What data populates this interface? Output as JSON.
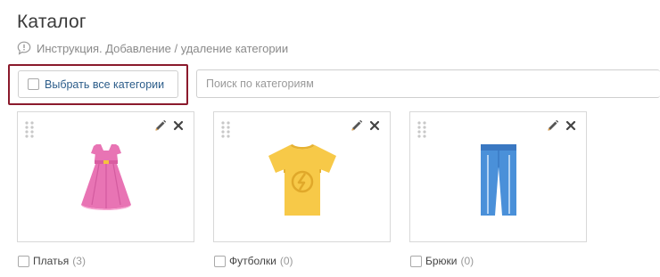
{
  "header": {
    "title": "Каталог",
    "help_text": "Инструкция. Добавление / удаление категории"
  },
  "toolbar": {
    "select_all_label": "Выбрать все категории",
    "search_placeholder": "Поиск по категориям",
    "search_value": ""
  },
  "categories": [
    {
      "name": "Платья",
      "count": "(3)",
      "icon": "dress-image",
      "color": "#e874b4"
    },
    {
      "name": "Футболки",
      "count": "(0)",
      "icon": "tshirt-image",
      "color": "#f7c948"
    },
    {
      "name": "Брюки",
      "count": "(0)",
      "icon": "pants-image",
      "color": "#4a90d9"
    }
  ],
  "colors": {
    "highlight_border": "#8b1a2c",
    "link_blue": "#2c5d8a"
  }
}
